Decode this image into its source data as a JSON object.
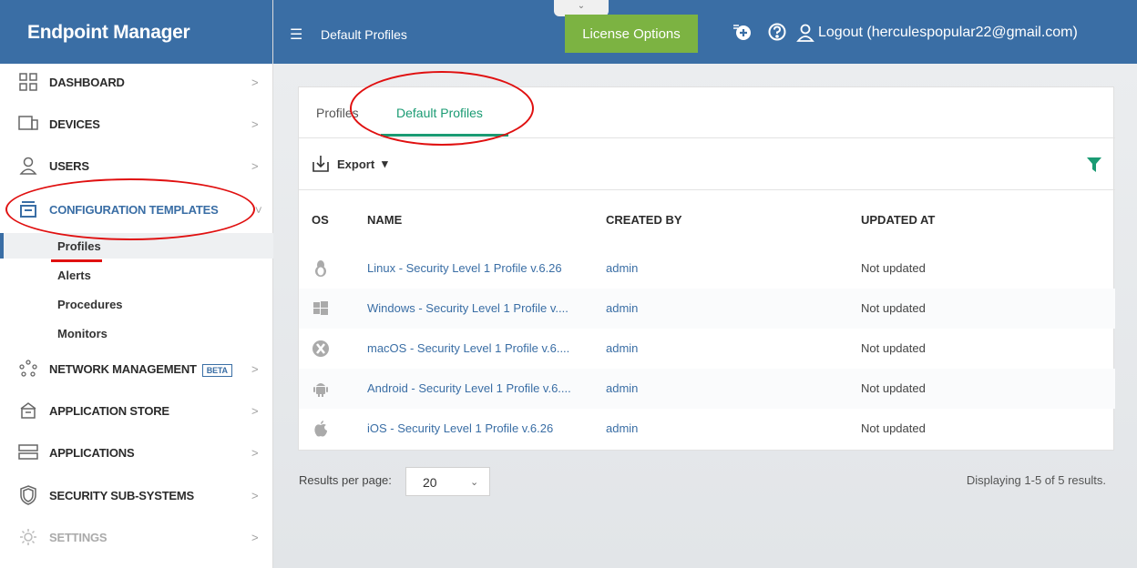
{
  "app": {
    "title": "Endpoint Manager",
    "page_title": "Default Profiles",
    "license_button": "License Options",
    "logout": "Logout (herculespopular22@gmail.com)",
    "collapse_glyph": "⌄",
    "colors": {
      "brand_blue": "#3a6ea5",
      "accent_green": "#1a9b73",
      "license_green": "#7cb342",
      "annotation_red": "#e01010"
    }
  },
  "sidebar": {
    "items": [
      {
        "label": "DASHBOARD",
        "icon": "dashboard-icon"
      },
      {
        "label": "DEVICES",
        "icon": "devices-icon"
      },
      {
        "label": "USERS",
        "icon": "user-icon"
      },
      {
        "label": "CONFIGURATION TEMPLATES",
        "icon": "templates-icon",
        "expanded": true
      },
      {
        "label": "NETWORK MANAGEMENT",
        "icon": "network-icon",
        "badge": "BETA"
      },
      {
        "label": "APPLICATION STORE",
        "icon": "store-icon"
      },
      {
        "label": "APPLICATIONS",
        "icon": "applications-icon"
      },
      {
        "label": "SECURITY SUB-SYSTEMS",
        "icon": "shield-icon"
      },
      {
        "label": "SETTINGS",
        "icon": "gear-icon"
      }
    ],
    "subitems": [
      "Profiles",
      "Alerts",
      "Procedures",
      "Monitors"
    ],
    "active_subitem": "Profiles"
  },
  "tabs": [
    {
      "label": "Profiles",
      "active": false
    },
    {
      "label": "Default Profiles",
      "active": true
    }
  ],
  "toolbar": {
    "export_label": "Export"
  },
  "table": {
    "columns": [
      "OS",
      "NAME",
      "CREATED BY",
      "UPDATED AT"
    ],
    "rows": [
      {
        "os": "linux-icon",
        "name": "Linux - Security Level 1 Profile v.6.26",
        "created_by": "admin",
        "updated_at": "Not updated"
      },
      {
        "os": "windows-icon",
        "name": "Windows - Security Level 1 Profile v....",
        "created_by": "admin",
        "updated_at": "Not updated"
      },
      {
        "os": "macos-icon",
        "name": "macOS - Security Level 1 Profile v.6....",
        "created_by": "admin",
        "updated_at": "Not updated"
      },
      {
        "os": "android-icon",
        "name": "Android - Security Level 1 Profile v.6....",
        "created_by": "admin",
        "updated_at": "Not updated"
      },
      {
        "os": "apple-icon",
        "name": "iOS - Security Level 1 Profile v.6.26",
        "created_by": "admin",
        "updated_at": "Not updated"
      }
    ]
  },
  "pagination": {
    "results_per_page_label": "Results per page:",
    "results_per_page_value": "20",
    "displaying": "Displaying 1-5 of 5 results."
  }
}
